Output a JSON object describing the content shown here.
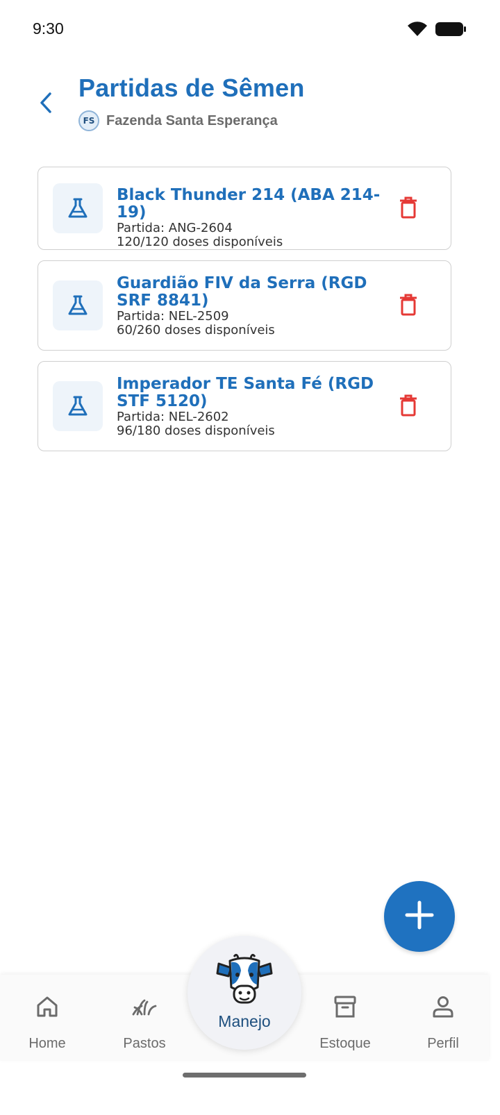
{
  "status_bar": {
    "time": "9:30"
  },
  "header": {
    "title": "Partidas de Sêmen",
    "farm_initials": "FS",
    "farm_name": "Fazenda Santa Esperança"
  },
  "batches": [
    {
      "name": "Black Thunder 214 (ABA 214-19)",
      "lot": "Partida: ANG-2604",
      "doses": "120/120 doses disponíveis"
    },
    {
      "name": "Guardião FIV da Serra (RGD SRF 8841)",
      "lot": "Partida: NEL-2509",
      "doses": "60/260 doses disponíveis"
    },
    {
      "name": "Imperador TE Santa Fé (RGD STF 5120)",
      "lot": "Partida: NEL-2602",
      "doses": "96/180 doses disponíveis"
    }
  ],
  "bottom_nav": {
    "home": "Home",
    "pastos": "Pastos",
    "manejo": "Manejo",
    "estoque": "Estoque",
    "perfil": "Perfil"
  },
  "colors": {
    "accent": "#1f6fba",
    "fab": "#1f72c0",
    "danger": "#e53935",
    "icon_bg": "#eef4fa"
  },
  "icons": {
    "back": "chevron-left-icon",
    "batch": "flask-icon",
    "delete": "trash-icon",
    "fab": "plus-icon",
    "home": "home-icon",
    "pastos": "grass-icon",
    "manejo": "cow-icon",
    "estoque": "archive-icon",
    "perfil": "person-icon"
  }
}
